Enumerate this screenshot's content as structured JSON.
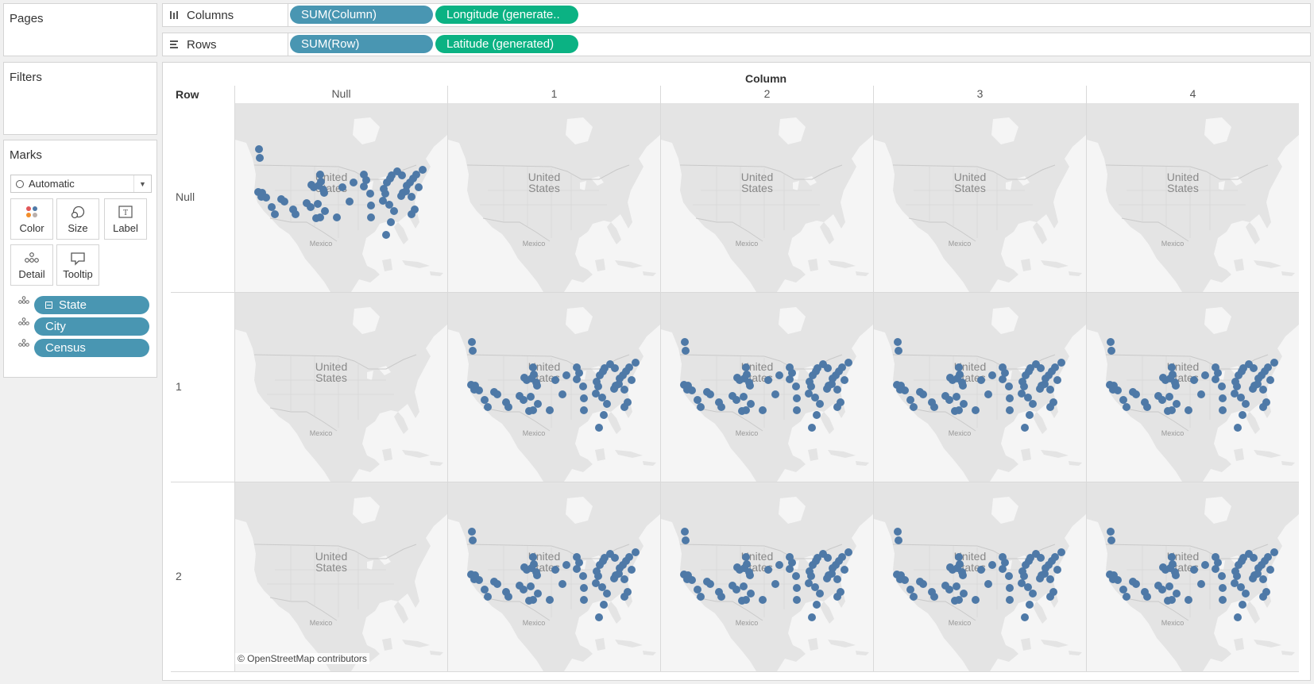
{
  "left_panel": {
    "pages_title": "Pages",
    "filters_title": "Filters",
    "marks_title": "Marks",
    "mark_type": "Automatic",
    "buttons": [
      {
        "label": "Color",
        "icon": "color-dots-icon"
      },
      {
        "label": "Size",
        "icon": "size-circles-icon"
      },
      {
        "label": "Label",
        "icon": "label-text-icon"
      },
      {
        "label": "Detail",
        "icon": "detail-dots-icon"
      },
      {
        "label": "Tooltip",
        "icon": "tooltip-bubble-icon"
      }
    ],
    "detail_fields": [
      {
        "label": "State",
        "has_minus_box": true
      },
      {
        "label": "City"
      },
      {
        "label": "Census"
      }
    ]
  },
  "shelves": {
    "columns_label": "Columns",
    "columns_pills": [
      "SUM(Column)",
      "Longitude (generate.."
    ],
    "rows_label": "Rows",
    "rows_pills": [
      "SUM(Row)",
      "Latitude (generated)"
    ]
  },
  "view": {
    "column_field": "Column",
    "row_field": "Row",
    "column_values": [
      "Null",
      "1",
      "2",
      "3",
      "4"
    ],
    "row_values": [
      "Null",
      "1",
      "2"
    ],
    "map_label_country": [
      "United",
      "States"
    ],
    "map_label_mexico": "Mexico",
    "attribution": "© OpenStreetMap contributors",
    "mark_color": "#4e79a7",
    "cells_with_marks": [
      {
        "row": "Null",
        "column": "Null"
      },
      {
        "row": "1",
        "column": "1"
      },
      {
        "row": "1",
        "column": "2"
      },
      {
        "row": "1",
        "column": "3"
      },
      {
        "row": "1",
        "column": "4"
      },
      {
        "row": "2",
        "column": "1"
      },
      {
        "row": "2",
        "column": "2"
      },
      {
        "row": "2",
        "column": "3"
      },
      {
        "row": "2",
        "column": "4"
      }
    ]
  }
}
